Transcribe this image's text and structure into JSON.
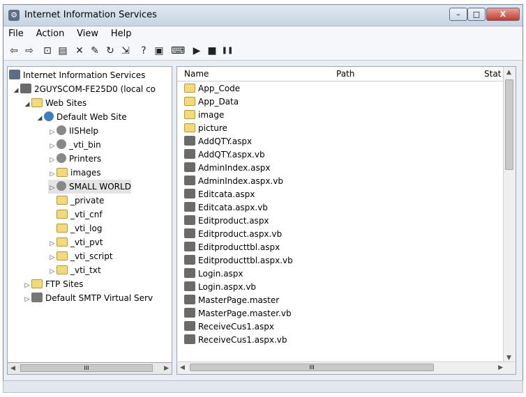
{
  "window": {
    "title": "Internet Information Services",
    "app_icon": "iis-icon"
  },
  "titlebar": {
    "minimize_label": "–",
    "maximize_label": "□",
    "close_label": "X"
  },
  "menu": [
    "File",
    "Action",
    "View",
    "Help"
  ],
  "toolbar": {
    "back": "⇦",
    "forward": "⇨",
    "up": "⊡",
    "show_tree": "▤",
    "delete": "✕",
    "properties": "✎",
    "refresh": "↻",
    "export": "⇲",
    "help": "?",
    "console": "▣",
    "computer": "⌨",
    "play": "▶",
    "stop": "■",
    "pause": "❚❚"
  },
  "tree": {
    "root": "Internet Information Services",
    "computer": "2GUYSCOM-FE25D0 (local co",
    "web_sites": "Web Sites",
    "default_site": "Default Web Site",
    "children": [
      "IISHelp",
      "_vti_bin",
      "Printers",
      "images",
      "SMALL WORLD",
      "_private",
      "_vti_cnf",
      "_vti_log",
      "_vti_pvt",
      "_vti_script",
      "_vti_txt"
    ],
    "ftp_sites": "FTP Sites",
    "smtp": "Default SMTP Virtual Serv"
  },
  "list": {
    "columns": {
      "name": "Name",
      "path": "Path",
      "status": "Stat"
    },
    "folders": [
      "App_Code",
      "App_Data",
      "image",
      "picture"
    ],
    "files": [
      "AddQTY.aspx",
      "AddQTY.aspx.vb",
      "AdminIndex.aspx",
      "AdminIndex.aspx.vb",
      "Editcata.aspx",
      "Editcata.aspx.vb",
      "Editproduct.aspx",
      "Editproduct.aspx.vb",
      "Editproducttbl.aspx",
      "Editproducttbl.aspx.vb",
      "Login.aspx",
      "Login.aspx.vb",
      "MasterPage.master",
      "MasterPage.master.vb",
      "ReceiveCus1.aspx",
      "ReceiveCus1.aspx.vb"
    ]
  },
  "scroll": {
    "tree_thumb": "III",
    "list_thumb": "III"
  }
}
